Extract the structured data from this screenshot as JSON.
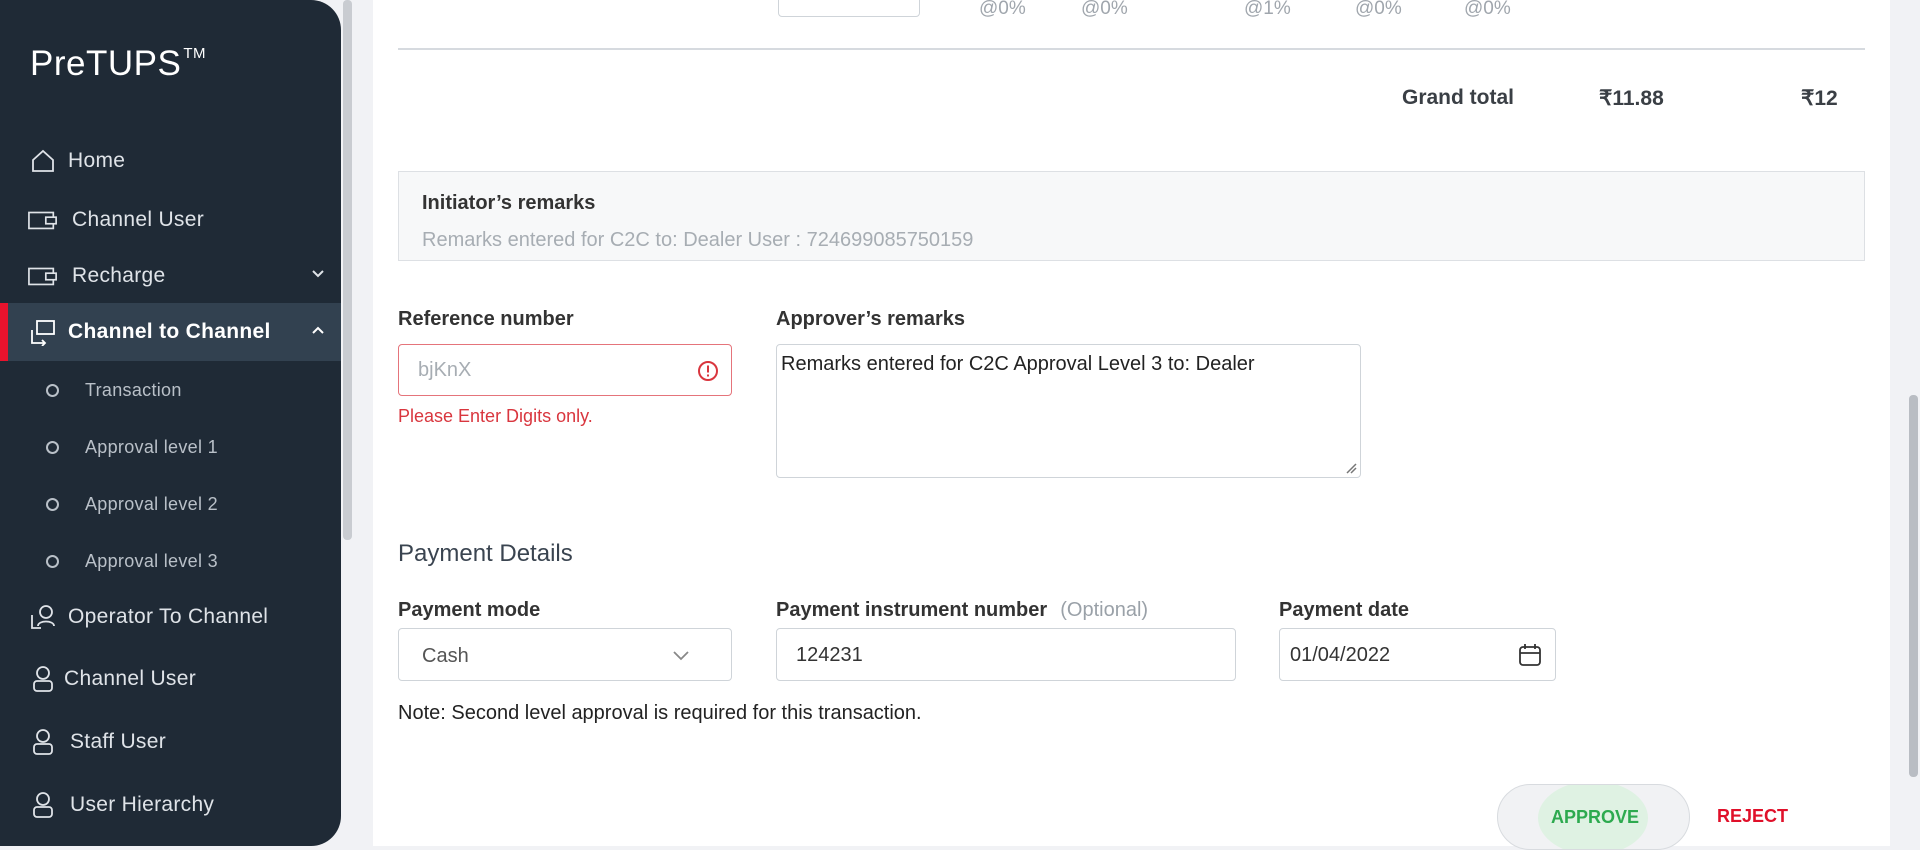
{
  "sidebar": {
    "brand": "PreTUPS",
    "brand_mark": "TM",
    "items": [
      {
        "label": "Home",
        "icon": "home-icon"
      },
      {
        "label": "Channel User",
        "icon": "wallet-icon"
      },
      {
        "label": "Recharge",
        "icon": "wallet-icon"
      },
      {
        "label": "Channel to Channel",
        "icon": "transfer-icon"
      },
      {
        "label": "Operator To Channel",
        "icon": "transfer-user-icon"
      },
      {
        "label": "Channel User",
        "icon": "user-icon"
      },
      {
        "label": "Staff User",
        "icon": "user-icon"
      },
      {
        "label": "User Hierarchy",
        "icon": "user-icon"
      }
    ],
    "sub_items": [
      "Transaction",
      "Approval level 1",
      "Approval level 2",
      "Approval level 3"
    ]
  },
  "summary": {
    "percents": [
      "@0%",
      "@0%",
      "@1%",
      "@0%",
      "@0%"
    ],
    "grand_total_label": "Grand total",
    "grand_total_value": "₹11.88",
    "grand_total_rounded": "₹12"
  },
  "initiator": {
    "title": "Initiator’s remarks",
    "text": "Remarks entered for C2C to: Dealer User : 724699085750159"
  },
  "reference": {
    "label": "Reference number",
    "placeholder": "bjKnX",
    "error": "Please Enter Digits only."
  },
  "approver": {
    "label": "Approver’s remarks",
    "value": "Remarks entered for C2C Approval Level 3 to: Dealer"
  },
  "payment": {
    "title": "Payment Details",
    "mode_label": "Payment mode",
    "mode_value": "Cash",
    "instrument_label": "Payment instrument number",
    "instrument_optional": "(Optional)",
    "instrument_value": "124231",
    "date_label": "Payment date",
    "date_value": "01/04/2022",
    "note": "Note: Second level approval is required for this transaction."
  },
  "actions": {
    "approve": "APPROVE",
    "reject": "REJECT"
  },
  "colors": {
    "sidebar_bg": "#1f2a36",
    "active_accent": "#e8132d",
    "error": "#d9363e",
    "approve_green": "#2daa4f",
    "reject_red": "#e0102a"
  }
}
